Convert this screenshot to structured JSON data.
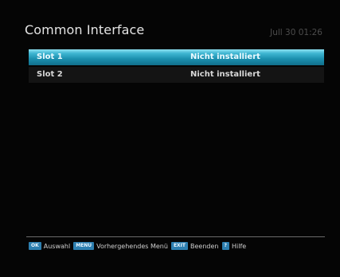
{
  "header": {
    "title": "Common Interface",
    "clock": "Jull 30 01:26"
  },
  "slots": [
    {
      "name": "Slot 1",
      "status": "Nicht installiert"
    },
    {
      "name": "Slot 2",
      "status": "Nicht installiert"
    }
  ],
  "footer": {
    "ok_key": "OK",
    "ok_label": "Auswahl",
    "menu_key": "MENU",
    "menu_label": "Vorhergehendes Menü",
    "exit_key": "EXIT",
    "exit_label": "Beenden",
    "help_key": "?",
    "help_label": "Hilfe"
  },
  "colors": {
    "selection_highlight": "#1b8fae",
    "button_key": "#2d7fb0",
    "background": "#050505"
  }
}
